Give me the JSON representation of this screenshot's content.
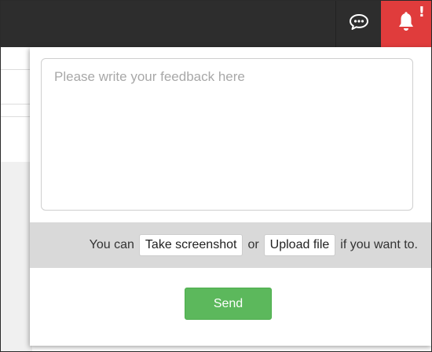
{
  "navbar": {
    "chat_icon": "chat-bubble-icon",
    "bell_icon": "bell-icon",
    "alert_mark": "!",
    "colors": {
      "bar": "#2d2d2d",
      "alert": "#e03c3c"
    }
  },
  "feedback": {
    "placeholder": "Please write your feedback here",
    "value": "",
    "attach": {
      "prefix": "You can",
      "screenshot_label": "Take screenshot",
      "or": "or",
      "upload_label": "Upload file",
      "suffix": "if you want to."
    },
    "send_label": "Send",
    "send_color": "#5cb85c"
  }
}
